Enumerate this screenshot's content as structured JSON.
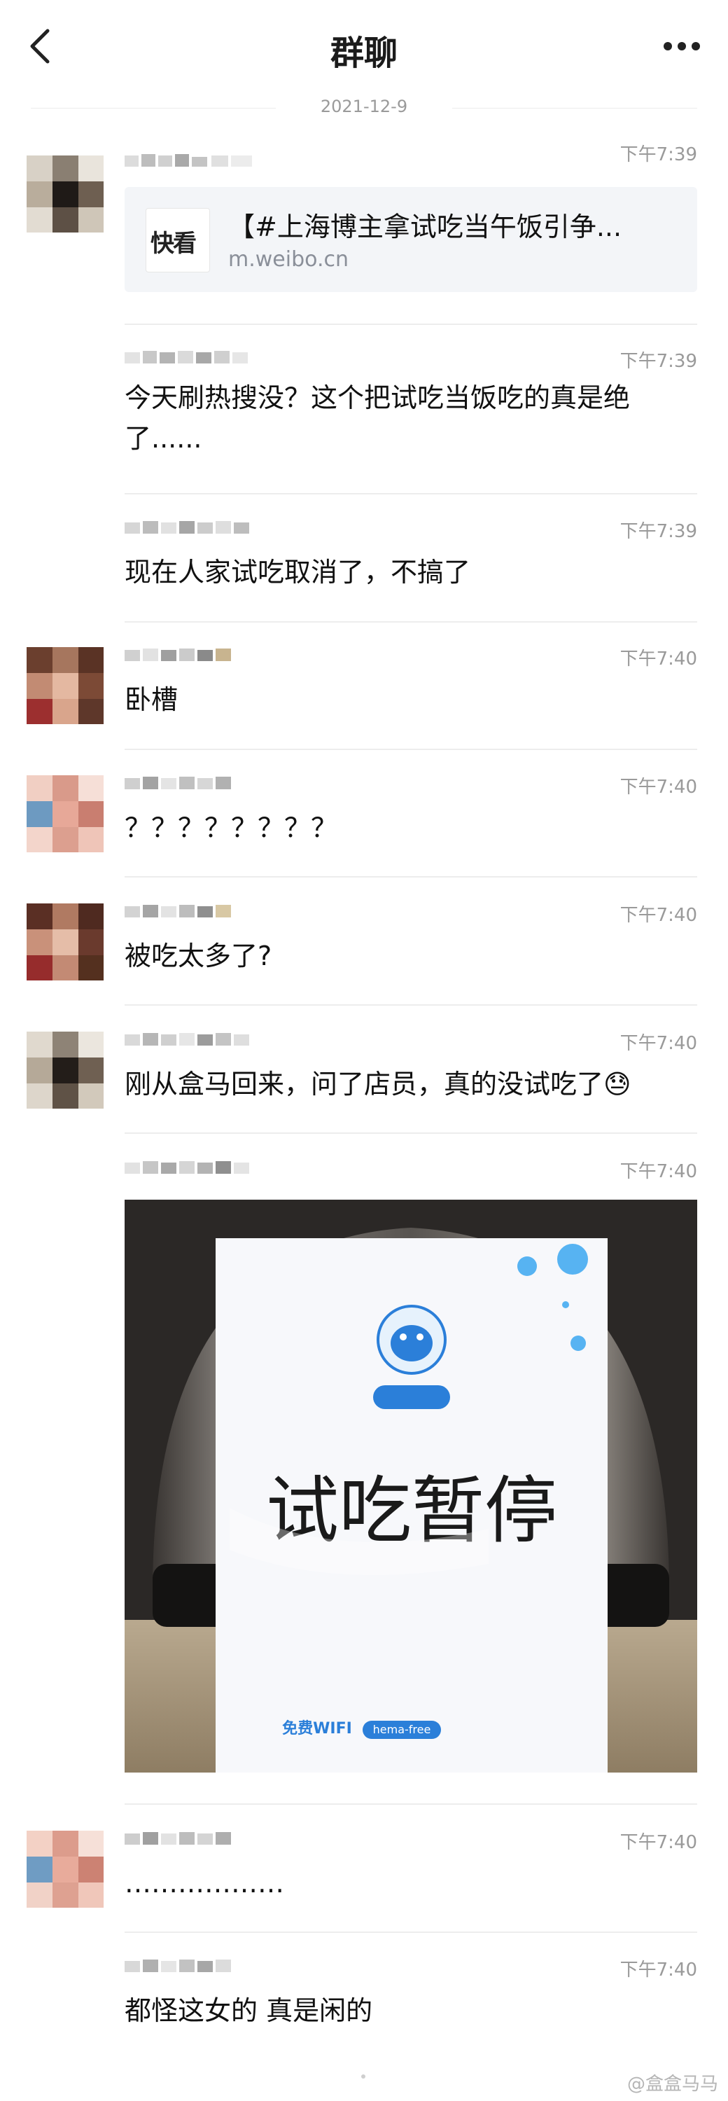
{
  "header": {
    "title": "群聊"
  },
  "date_separator": "2021-12-9",
  "messages": [
    {
      "time": "下午7:39",
      "link": {
        "source": "快看",
        "title": "【#上海博主拿试吃当午饭引争...",
        "url": "m.weibo.cn"
      }
    },
    {
      "time": "下午7:39",
      "text": "今天刷热搜没？这个把试吃当饭吃的真是绝了......"
    },
    {
      "time": "下午7:39",
      "text": "现在人家试吃取消了，不搞了"
    },
    {
      "time": "下午7:40",
      "text": "卧槽"
    },
    {
      "time": "下午7:40",
      "text": "？？？？？？？？"
    },
    {
      "time": "下午7:40",
      "text": "被吃太多了?"
    },
    {
      "time": "下午7:40",
      "text": "刚从盒马回来，问了店员，真的没试吃了😓"
    },
    {
      "time": "下午7:40",
      "photo": {
        "sign_text": "试吃暂停",
        "wifi_text": "免费WIFI",
        "wifi_ssid": "hema-free"
      }
    },
    {
      "time": "下午7:40",
      "text": "………………"
    },
    {
      "time": "下午7:40",
      "text": "都怪这女的 真是闲的"
    }
  ],
  "watermark": "@盒盒马马",
  "colors": {
    "time_gray": "#9a9a9a",
    "card_bg": "#f3f5f8",
    "divider": "#ededed"
  }
}
